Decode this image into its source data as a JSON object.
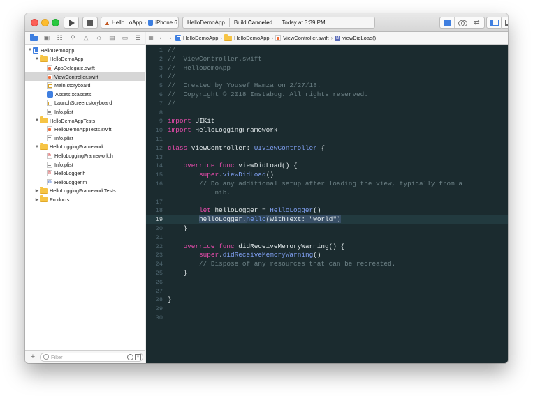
{
  "toolbar": {
    "scheme_app": "Hello...oApp",
    "scheme_device": "iPhone 6",
    "activity_project": "HelloDemoApp",
    "activity_status_prefix": "Build",
    "activity_status": "Canceled",
    "activity_time": "Today at 3:39 PM"
  },
  "navigator": {
    "filter_placeholder": "Filter",
    "items": [
      {
        "label": "HelloDemoApp",
        "icon": "project-icon",
        "indent": 0,
        "disclosure": "open"
      },
      {
        "label": "HelloDemoApp",
        "icon": "folder-icon",
        "indent": 1,
        "disclosure": "open"
      },
      {
        "label": "AppDelegate.swift",
        "icon": "swift-file-icon",
        "indent": 2,
        "disclosure": "none"
      },
      {
        "label": "ViewController.swift",
        "icon": "swift-file-icon",
        "indent": 2,
        "disclosure": "none",
        "selected": true
      },
      {
        "label": "Main.storyboard",
        "icon": "storyboard-icon",
        "indent": 2,
        "disclosure": "none"
      },
      {
        "label": "Assets.xcassets",
        "icon": "assets-icon",
        "indent": 2,
        "disclosure": "none"
      },
      {
        "label": "LaunchScreen.storyboard",
        "icon": "storyboard-icon",
        "indent": 2,
        "disclosure": "none"
      },
      {
        "label": "Info.plist",
        "icon": "plist-icon",
        "indent": 2,
        "disclosure": "none"
      },
      {
        "label": "HelloDemoAppTests",
        "icon": "folder-icon",
        "indent": 1,
        "disclosure": "open"
      },
      {
        "label": "HelloDemoAppTests.swift",
        "icon": "swift-file-icon",
        "indent": 2,
        "disclosure": "none"
      },
      {
        "label": "Info.plist",
        "icon": "plist-icon",
        "indent": 2,
        "disclosure": "none"
      },
      {
        "label": "HelloLoggingFramework",
        "icon": "folder-icon",
        "indent": 1,
        "disclosure": "open"
      },
      {
        "label": "HelloLoggingFramework.h",
        "icon": "header-file-icon",
        "indent": 2,
        "disclosure": "none"
      },
      {
        "label": "Info.plist",
        "icon": "plist-icon",
        "indent": 2,
        "disclosure": "none"
      },
      {
        "label": "HelloLogger.h",
        "icon": "header-file-icon",
        "indent": 2,
        "disclosure": "none"
      },
      {
        "label": "HelloLogger.m",
        "icon": "objc-file-icon",
        "indent": 2,
        "disclosure": "none"
      },
      {
        "label": "HelloLoggingFrameworkTests",
        "icon": "folder-icon",
        "indent": 1,
        "disclosure": "closed"
      },
      {
        "label": "Products",
        "icon": "folder-icon",
        "indent": 1,
        "disclosure": "closed"
      }
    ]
  },
  "jumpbar": {
    "crumbs": [
      "HelloDemoApp",
      "HelloDemoApp",
      "ViewController.swift",
      "viewDidLoad()"
    ]
  },
  "editor": {
    "current_line": 19,
    "lines": [
      {
        "n": "1",
        "tokens": [
          {
            "t": "//",
            "c": "cmt"
          }
        ]
      },
      {
        "n": "2",
        "tokens": [
          {
            "t": "//  ViewController.swift",
            "c": "cmt"
          }
        ]
      },
      {
        "n": "3",
        "tokens": [
          {
            "t": "//  HelloDemoApp",
            "c": "cmt"
          }
        ]
      },
      {
        "n": "4",
        "tokens": [
          {
            "t": "//",
            "c": "cmt"
          }
        ]
      },
      {
        "n": "5",
        "tokens": [
          {
            "t": "//  Created by Yousef Hamza on 2/27/18.",
            "c": "cmt"
          }
        ]
      },
      {
        "n": "6",
        "tokens": [
          {
            "t": "//  Copyright © 2018 Instabug. All rights reserved.",
            "c": "cmt"
          }
        ]
      },
      {
        "n": "7",
        "tokens": [
          {
            "t": "//",
            "c": "cmt"
          }
        ]
      },
      {
        "n": "8",
        "tokens": []
      },
      {
        "n": "9",
        "tokens": [
          {
            "t": "import",
            "c": "kw"
          },
          {
            "t": " UIKit",
            "c": ""
          }
        ]
      },
      {
        "n": "10",
        "tokens": [
          {
            "t": "import",
            "c": "kw"
          },
          {
            "t": " HelloLoggingFramework",
            "c": ""
          }
        ]
      },
      {
        "n": "11",
        "tokens": []
      },
      {
        "n": "12",
        "tokens": [
          {
            "t": "class",
            "c": "kw"
          },
          {
            "t": " ViewController: ",
            "c": ""
          },
          {
            "t": "UIViewController",
            "c": "ty"
          },
          {
            "t": " {",
            "c": ""
          }
        ]
      },
      {
        "n": "13",
        "tokens": []
      },
      {
        "n": "14",
        "tokens": [
          {
            "t": "    ",
            "c": ""
          },
          {
            "t": "override func",
            "c": "kw"
          },
          {
            "t": " viewDidLoad() {",
            "c": ""
          }
        ]
      },
      {
        "n": "15",
        "tokens": [
          {
            "t": "        ",
            "c": ""
          },
          {
            "t": "super",
            "c": "kw"
          },
          {
            "t": ".",
            "c": ""
          },
          {
            "t": "viewDidLoad",
            "c": "ty"
          },
          {
            "t": "()",
            "c": ""
          }
        ]
      },
      {
        "n": "16",
        "tokens": [
          {
            "t": "        // Do any additional setup after loading the view, typically from a",
            "c": "cmt"
          }
        ]
      },
      {
        "n": "",
        "tokens": [
          {
            "t": "            nib.",
            "c": "cmt"
          }
        ]
      },
      {
        "n": "17",
        "tokens": []
      },
      {
        "n": "18",
        "tokens": [
          {
            "t": "        ",
            "c": ""
          },
          {
            "t": "let",
            "c": "kw"
          },
          {
            "t": " helloLogger = ",
            "c": ""
          },
          {
            "t": "HelloLogger",
            "c": "ty"
          },
          {
            "t": "()",
            "c": ""
          }
        ]
      },
      {
        "n": "19",
        "tokens": [
          {
            "t": "        ",
            "c": ""
          },
          {
            "t": "helloLogger.",
            "c": "hl"
          },
          {
            "t": "hello",
            "c": "fn-hl"
          },
          {
            "t": "(",
            "c": "hl"
          },
          {
            "t": "withText",
            "c": "hl"
          },
          {
            "t": ": ",
            "c": "hl"
          },
          {
            "t": "\"World\"",
            "c": "str hl"
          },
          {
            "t": ")",
            "c": "hl"
          }
        ]
      },
      {
        "n": "20",
        "tokens": [
          {
            "t": "    }",
            "c": ""
          }
        ]
      },
      {
        "n": "21",
        "tokens": []
      },
      {
        "n": "22",
        "tokens": [
          {
            "t": "    ",
            "c": ""
          },
          {
            "t": "override func",
            "c": "kw"
          },
          {
            "t": " didReceiveMemoryWarning() {",
            "c": ""
          }
        ]
      },
      {
        "n": "23",
        "tokens": [
          {
            "t": "        ",
            "c": ""
          },
          {
            "t": "super",
            "c": "kw"
          },
          {
            "t": ".",
            "c": ""
          },
          {
            "t": "didReceiveMemoryWarning",
            "c": "ty"
          },
          {
            "t": "()",
            "c": ""
          }
        ]
      },
      {
        "n": "24",
        "tokens": [
          {
            "t": "        // Dispose of any resources that can be recreated.",
            "c": "cmt"
          }
        ]
      },
      {
        "n": "25",
        "tokens": [
          {
            "t": "    }",
            "c": ""
          }
        ]
      },
      {
        "n": "26",
        "tokens": []
      },
      {
        "n": "27",
        "tokens": []
      },
      {
        "n": "28",
        "tokens": [
          {
            "t": "}",
            "c": ""
          }
        ]
      },
      {
        "n": "29",
        "tokens": []
      },
      {
        "n": "30",
        "tokens": []
      }
    ]
  },
  "colors": {
    "editor_background": "#1b2b2f",
    "keyword": "#ea4cae",
    "type": "#7f9ff0",
    "string": "#f3413f",
    "comment": "#6c8085",
    "selection": "#d6d6d6",
    "accent": "#3f7fe0"
  }
}
